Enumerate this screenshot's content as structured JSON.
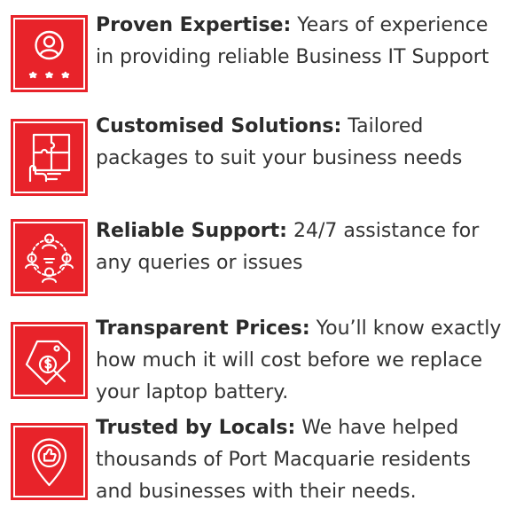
{
  "features": [
    {
      "icon": "expert-rating-icon",
      "title": "Proven Expertise:",
      "text": " Years of experience in providing reliable Business IT Support"
    },
    {
      "icon": "puzzle-hand-icon",
      "title": "Customised Solutions:",
      "text": " Tailored packages to suit your business needs"
    },
    {
      "icon": "team-network-icon",
      "title": "Reliable Support:",
      "text": " 24/7 assistance for any queries or issues"
    },
    {
      "icon": "price-tag-search-icon",
      "title": "Transparent Prices:",
      "text": " You’ll know exactly how much it will cost before we replace your laptop battery."
    },
    {
      "icon": "location-thumbs-up-icon",
      "title": "Trusted by Locals:",
      "text": " We have helped thousands of Port Macquarie residents and businesses with their needs."
    }
  ],
  "colors": {
    "accent": "#e8232a",
    "text": "#333333",
    "icon": "#ffffff"
  }
}
